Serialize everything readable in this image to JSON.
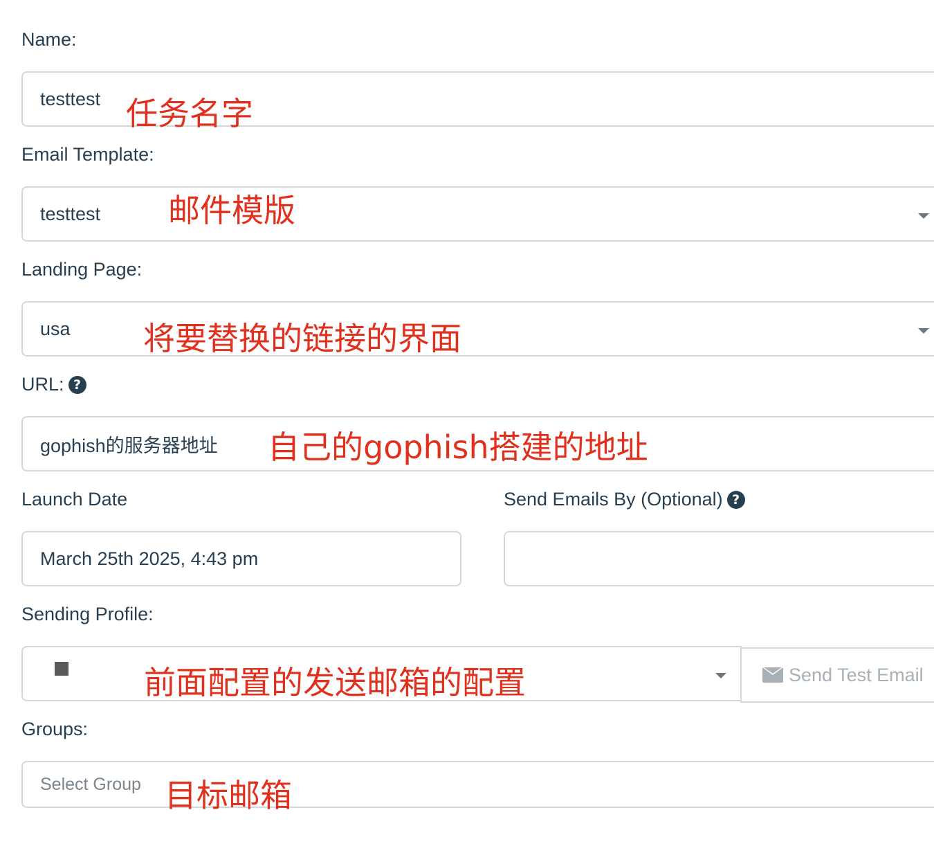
{
  "form": {
    "name": {
      "label": "Name:",
      "value": "testtest",
      "annotation": "任务名字"
    },
    "email_template": {
      "label": "Email Template:",
      "value": "testtest",
      "annotation": "邮件模版"
    },
    "landing_page": {
      "label": "Landing Page:",
      "value": "usa",
      "annotation": "将要替换的链接的界面"
    },
    "url": {
      "label": "URL:",
      "value": "gophish的服务器地址",
      "annotation": "自己的gophish搭建的地址",
      "help_icon": "question-circle-icon"
    },
    "launch_date": {
      "label": "Launch Date",
      "value": "March 25th 2025, 4:43 pm"
    },
    "send_emails_by": {
      "label": "Send Emails By (Optional)",
      "value": "",
      "help_icon": "question-circle-icon"
    },
    "sending_profile": {
      "label": "Sending Profile:",
      "value": "■",
      "annotation": "前面配置的发送邮箱的配置",
      "send_test_label": "Send Test Email",
      "send_test_icon": "envelope-icon"
    },
    "groups": {
      "label": "Groups:",
      "placeholder": "Select Group",
      "annotation": "目标邮箱"
    }
  },
  "colors": {
    "text": "#283f50",
    "border": "#d4d8dc",
    "annotation": "#e0301e",
    "disabled": "#a7b0b7"
  }
}
